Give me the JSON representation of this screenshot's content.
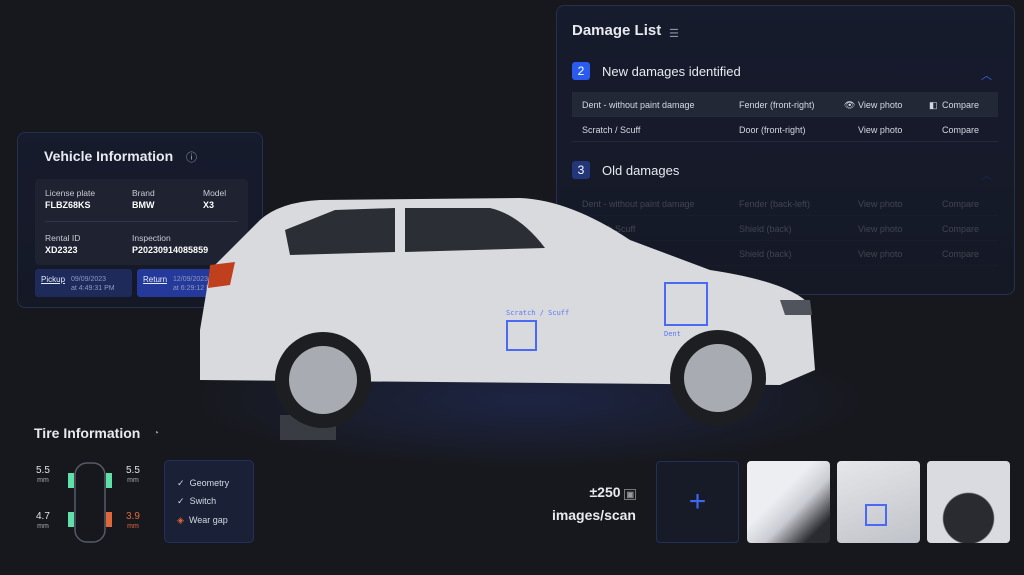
{
  "damage_list": {
    "title": "Damage List",
    "icon": "list-icon",
    "new": {
      "count": "2",
      "title": "New damages identified",
      "rows": [
        {
          "type": "Dent - without paint damage",
          "part": "Fender (front-right)",
          "view": "View photo",
          "compare": "Compare"
        },
        {
          "type": "Scratch / Scuff",
          "part": "Door (front-right)",
          "view": "View photo",
          "compare": "Compare"
        }
      ]
    },
    "old": {
      "count": "3",
      "title": "Old damages",
      "rows": [
        {
          "type": "Dent - without paint damage",
          "part": "Fender (back-left)",
          "view": "View photo",
          "compare": "Compare"
        },
        {
          "type": "Scratch Scuff",
          "part": "Shield (back)",
          "view": "View photo",
          "compare": "Compare"
        },
        {
          "type": "",
          "part": "Shield (back)",
          "view": "View photo",
          "compare": "Compare"
        }
      ]
    }
  },
  "vehicle": {
    "title": "Vehicle Information",
    "license_label": "License plate",
    "license": "FLBZ68KS",
    "brand_label": "Brand",
    "brand": "BMW",
    "model_label": "Model",
    "model": "X3",
    "rental_label": "Rental ID",
    "rental": "XD2323",
    "inspection_label": "Inspection",
    "inspection": "P20230914085859",
    "pickup": {
      "label": "Pickup",
      "date": "09/09/2023",
      "time": "at 4:49:31 PM"
    },
    "return": {
      "label": "Return",
      "date": "12/09/2023",
      "time": "at 6:29:12 PM"
    }
  },
  "car_labels": {
    "scratch": "Scratch / Scuff",
    "dent": "Dent"
  },
  "tire": {
    "title": "Tire Information",
    "fl": "5.5",
    "fr": "5.5",
    "rl": "4.7",
    "rr": "3.9",
    "unit": "mm",
    "checks": [
      "Geometry",
      "Switch",
      "Wear gap"
    ],
    "colors": {
      "ok": "#5fe0a8",
      "warn": "#e0673c"
    }
  },
  "scan": {
    "count": "±250",
    "label": "images/scan"
  },
  "accent": "#2a5bef"
}
